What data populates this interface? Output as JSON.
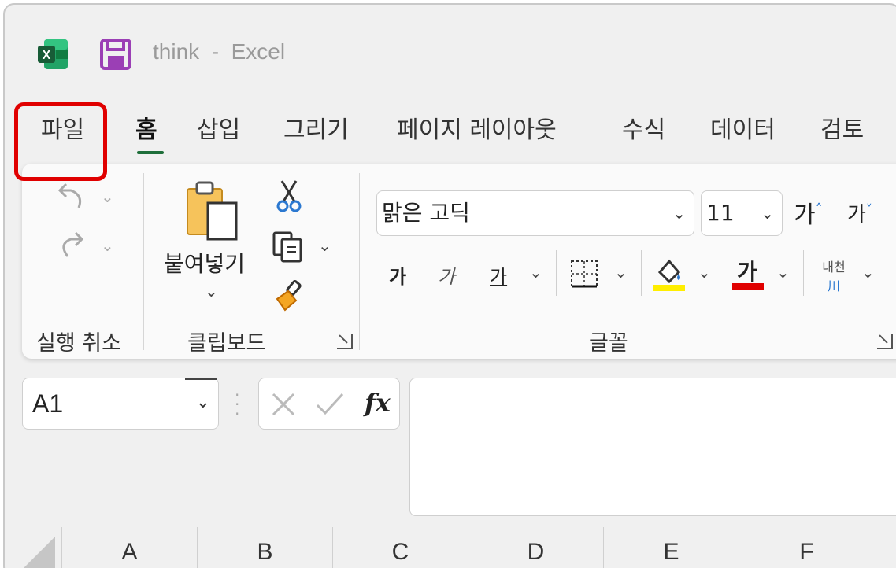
{
  "titlebar": {
    "doc_title": "think  -  Excel",
    "app_icon": "excel-icon",
    "save_icon": "save-icon"
  },
  "tabs": [
    {
      "label": "파일",
      "active": false
    },
    {
      "label": "홈",
      "active": true
    },
    {
      "label": "삽입",
      "active": false
    },
    {
      "label": "그리기",
      "active": false
    },
    {
      "label": "페이지 레이아웃",
      "active": false
    },
    {
      "label": "수식",
      "active": false
    },
    {
      "label": "데이터",
      "active": false
    },
    {
      "label": "검토",
      "active": false
    }
  ],
  "ribbon": {
    "undo_group_label": "실행 취소",
    "clipboard_group_label": "클립보드",
    "paste_label": "붙여넣기",
    "font_group_label": "글꼴",
    "font_name": "맑은 고딕",
    "font_size": "11",
    "grow_font": "가",
    "shrink_font": "가",
    "bold": "가",
    "italic": "가",
    "underline": "가",
    "font_color_glyph": "가",
    "phonetic_top": "내천",
    "phonetic_bottom": "川",
    "colors": {
      "fill_color": "#ffee00",
      "font_color": "#e00000",
      "accent_green": "#1e6e3a",
      "highlight_red": "#e00000"
    }
  },
  "formula_bar": {
    "name_box": "A1",
    "fx": "fx"
  },
  "columns": [
    "A",
    "B",
    "C",
    "D",
    "E",
    "F"
  ]
}
